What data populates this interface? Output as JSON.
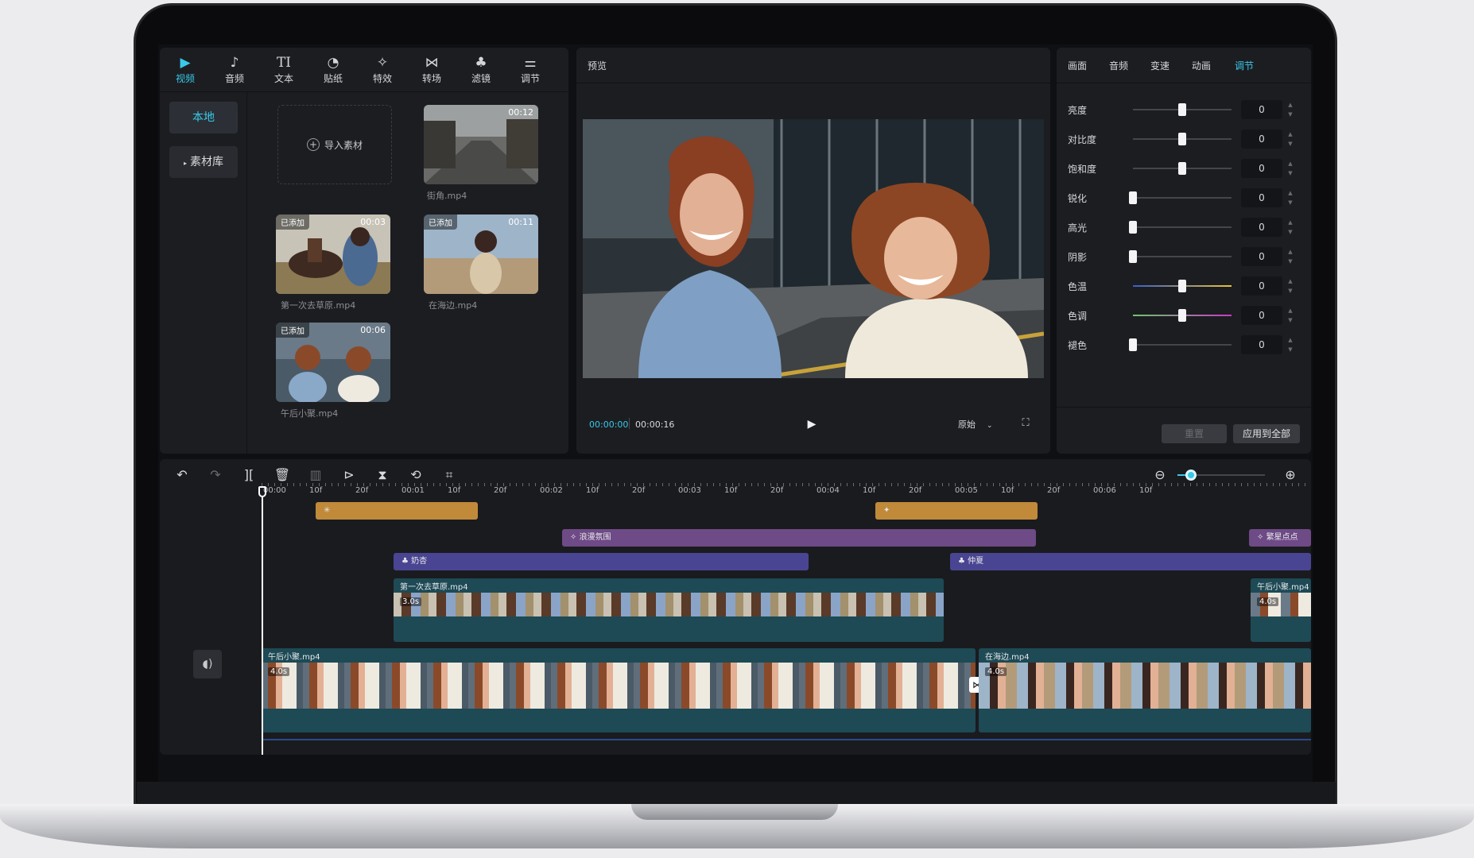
{
  "toolbar": {
    "tabs": [
      {
        "label": "视频",
        "icon": "video-icon"
      },
      {
        "label": "音频",
        "icon": "audio-icon"
      },
      {
        "label": "文本",
        "icon": "text-icon"
      },
      {
        "label": "贴纸",
        "icon": "sticker-icon"
      },
      {
        "label": "特效",
        "icon": "effects-icon"
      },
      {
        "label": "转场",
        "icon": "transition-icon"
      },
      {
        "label": "滤镜",
        "icon": "filter-icon"
      },
      {
        "label": "调节",
        "icon": "adjust-icon"
      }
    ],
    "active_index": 0
  },
  "media": {
    "sidebar": [
      {
        "label": "本地"
      },
      {
        "label": "素材库"
      }
    ],
    "import_label": "导入素材",
    "clips": [
      {
        "name": "街角.mp4",
        "duration": "00:12",
        "added": ""
      },
      {
        "name": "第一次去草原.mp4",
        "duration": "00:03",
        "added": "已添加"
      },
      {
        "name": "在海边.mp4",
        "duration": "00:11",
        "added": "已添加"
      },
      {
        "name": "午后小聚.mp4",
        "duration": "00:06",
        "added": "已添加"
      }
    ]
  },
  "preview": {
    "title": "预览",
    "current_time": "00:00:00",
    "total_time": "00:00:16",
    "ratio_label": "原始"
  },
  "adjust": {
    "tabs": [
      {
        "label": "画面"
      },
      {
        "label": "音频"
      },
      {
        "label": "变速"
      },
      {
        "label": "动画"
      },
      {
        "label": "调节"
      }
    ],
    "active_index": 4,
    "rows": [
      {
        "label": "亮度",
        "value": "0",
        "level": 0.5
      },
      {
        "label": "对比度",
        "value": "0",
        "level": 0.5
      },
      {
        "label": "饱和度",
        "value": "0",
        "level": 0.5
      },
      {
        "label": "锐化",
        "value": "0",
        "level": 0
      },
      {
        "label": "高光",
        "value": "0",
        "level": 0
      },
      {
        "label": "阴影",
        "value": "0",
        "level": 0
      },
      {
        "label": "色温",
        "value": "0",
        "level": 0.5
      },
      {
        "label": "色调",
        "value": "0",
        "level": 0.5
      },
      {
        "label": "褪色",
        "value": "0",
        "level": 0
      }
    ],
    "reset_label": "重置",
    "apply_all_label": "应用到全部"
  },
  "timeline": {
    "ruler": [
      "00:00",
      "10f",
      "20f",
      "00:01",
      "10f",
      "20f",
      "00:02",
      "10f",
      "20f",
      "00:03",
      "10f",
      "20f",
      "00:04",
      "10f",
      "20f",
      "00:05",
      "10f",
      "20f",
      "00:06",
      "10f"
    ],
    "effect_tracks": [
      {
        "label": "浪漫氛围",
        "color": "#6e4a86"
      },
      {
        "label": "繁星点点",
        "color": "#6e4a86"
      }
    ],
    "filter_tracks": [
      {
        "label": "奶杏",
        "color": "#4a4592"
      },
      {
        "label": "仲夏",
        "color": "#4a4592"
      }
    ],
    "overlay_clips": [
      {
        "name": "第一次去草原.mp4",
        "duration": "3.0s"
      },
      {
        "name": "午后小聚.mp4",
        "duration": "4.0s"
      }
    ],
    "main_clips": [
      {
        "name": "午后小聚.mp4",
        "duration": "4.0s"
      },
      {
        "name": "在海边.mp4",
        "duration": "4.0s"
      }
    ],
    "zoom_level": 0.15
  },
  "colors": {
    "accent": "#38c8e8",
    "panel": "#1c1d21",
    "sticker_track": "#c08a3a"
  }
}
